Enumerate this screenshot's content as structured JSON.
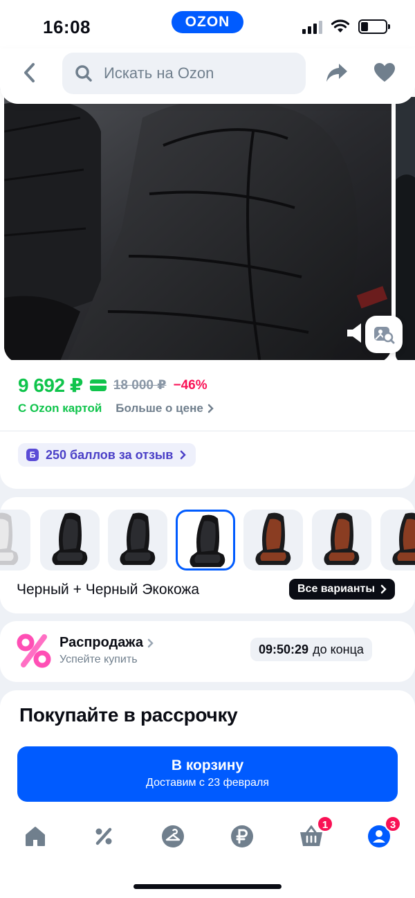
{
  "status_bar": {
    "time": "16:08",
    "center_logo": "OZON",
    "battery_level": 0.25,
    "icons": [
      "signal-icon",
      "wifi-icon",
      "battery-icon"
    ]
  },
  "header": {
    "back_icon": "chevron-left-icon",
    "search_placeholder": "Искать на Ozon",
    "share_icon": "share-arrow-icon",
    "favorite_icon": "heart-icon"
  },
  "gallery": {
    "sound_icon": "speaker-icon",
    "lens_icon": "image-search-icon"
  },
  "price": {
    "current": "9 692 ₽",
    "old": "18 000 ₽",
    "discount": "−46%",
    "ozon_card_label": "С Ozon картой",
    "more_label": "Больше о цене"
  },
  "bonus": {
    "badge": "Б",
    "text": "250 баллов за отзыв"
  },
  "variants": {
    "selected_label": "Черный + Черный Экокожа",
    "all_button": "Все варианты",
    "items": [
      {
        "color": "white",
        "selected": false
      },
      {
        "color": "black",
        "selected": false
      },
      {
        "color": "black",
        "selected": false
      },
      {
        "color": "black",
        "selected": true
      },
      {
        "color": "brown",
        "selected": false
      },
      {
        "color": "brown",
        "selected": false
      },
      {
        "color": "brown",
        "selected": false
      }
    ]
  },
  "sale": {
    "title": "Распродажа",
    "subtitle": "Успейте купить",
    "timer": "09:50:29",
    "timer_suffix": "до конца"
  },
  "installment": {
    "title": "Покупайте в рассрочку"
  },
  "cart_button": {
    "label": "В корзину",
    "delivery": "Доставим с 23 февраля"
  },
  "tabbar": {
    "items": [
      {
        "name": "home-icon",
        "badge": ""
      },
      {
        "name": "percent-icon",
        "badge": ""
      },
      {
        "name": "hanger-icon",
        "badge": ""
      },
      {
        "name": "ruble-icon",
        "badge": ""
      },
      {
        "name": "cart-icon",
        "badge": "1"
      },
      {
        "name": "profile-icon",
        "badge": "3"
      }
    ]
  },
  "colors": {
    "accent": "#005bff",
    "price_green": "#10c44c",
    "discount_red": "#f91155",
    "bonus_purple": "#4a3fc7"
  }
}
